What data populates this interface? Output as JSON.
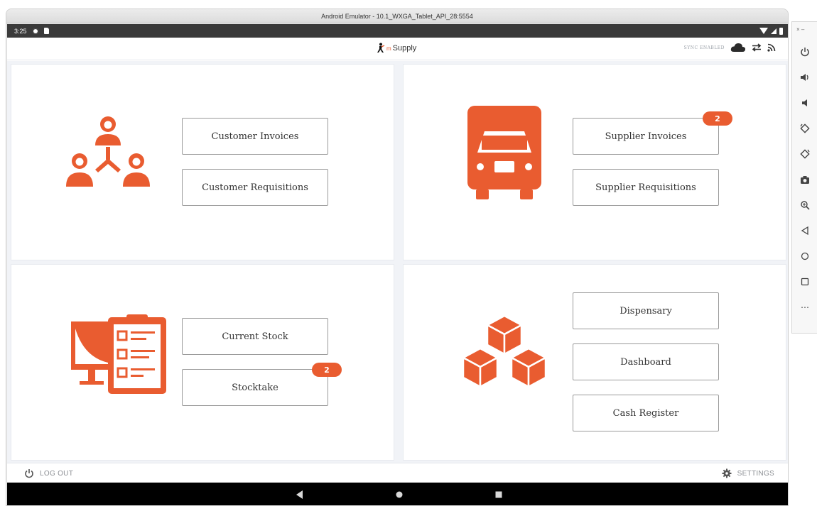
{
  "emulator": {
    "title": "Android Emulator - 10.1_WXGA_Tablet_API_28:5554",
    "side_top": "× –",
    "more_label": "⋯"
  },
  "status_bar": {
    "time": "3:25"
  },
  "header": {
    "brand_prefix": "m",
    "brand_name": "Supply",
    "sync_status": "SYNC ENABLED"
  },
  "panels": {
    "customer": {
      "buttons": [
        "Customer Invoices",
        "Customer Requisitions"
      ]
    },
    "supplier": {
      "buttons": [
        "Supplier Invoices",
        "Supplier Requisitions"
      ],
      "supplier_invoices_badge": "2"
    },
    "stock": {
      "buttons": [
        "Current Stock",
        "Stocktake"
      ],
      "stocktake_badge": "2"
    },
    "misc": {
      "buttons": [
        "Dispensary",
        "Dashboard",
        "Cash Register"
      ]
    }
  },
  "footer": {
    "logout": "LOG OUT",
    "settings": "SETTINGS"
  },
  "colors": {
    "accent": "#e95c30",
    "dash_bg": "#f1f3f7"
  }
}
